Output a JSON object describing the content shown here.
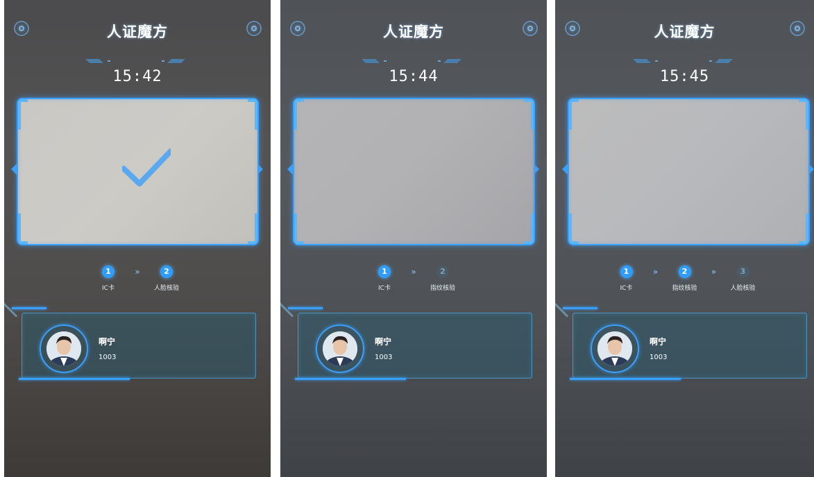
{
  "screens": [
    {
      "title": "人证魔方",
      "time": "15:42",
      "camera_state": "verified",
      "steps": [
        {
          "number": "1",
          "label": "IC卡",
          "active": true
        },
        {
          "number": "2",
          "label": "人脸核验",
          "active": true
        }
      ],
      "person": {
        "name": "啊宁",
        "id": "1003"
      }
    },
    {
      "title": "人证魔方",
      "time": "15:44",
      "camera_state": "scanning",
      "steps": [
        {
          "number": "1",
          "label": "IC卡",
          "active": true
        },
        {
          "number": "2",
          "label": "指纹核验",
          "active": false
        }
      ],
      "person": {
        "name": "啊宁",
        "id": "1003"
      }
    },
    {
      "title": "人证魔方",
      "time": "15:45",
      "camera_state": "scanning",
      "steps": [
        {
          "number": "1",
          "label": "IC卡",
          "active": true
        },
        {
          "number": "2",
          "label": "指纹核验",
          "active": true
        },
        {
          "number": "3",
          "label": "人脸核验",
          "active": false
        }
      ],
      "person": {
        "name": "啊宁",
        "id": "1003"
      }
    }
  ],
  "step_separator": "»",
  "icons": {
    "header_left": "refresh-icon",
    "header_right": "settings-icon",
    "camera_check": "checkmark-icon",
    "camera_left": "chevron-left-icon",
    "camera_right": "chevron-right-icon"
  },
  "colors": {
    "accent": "#3aa0ff",
    "check": "#5aa8f0",
    "text": "#ffffff"
  }
}
